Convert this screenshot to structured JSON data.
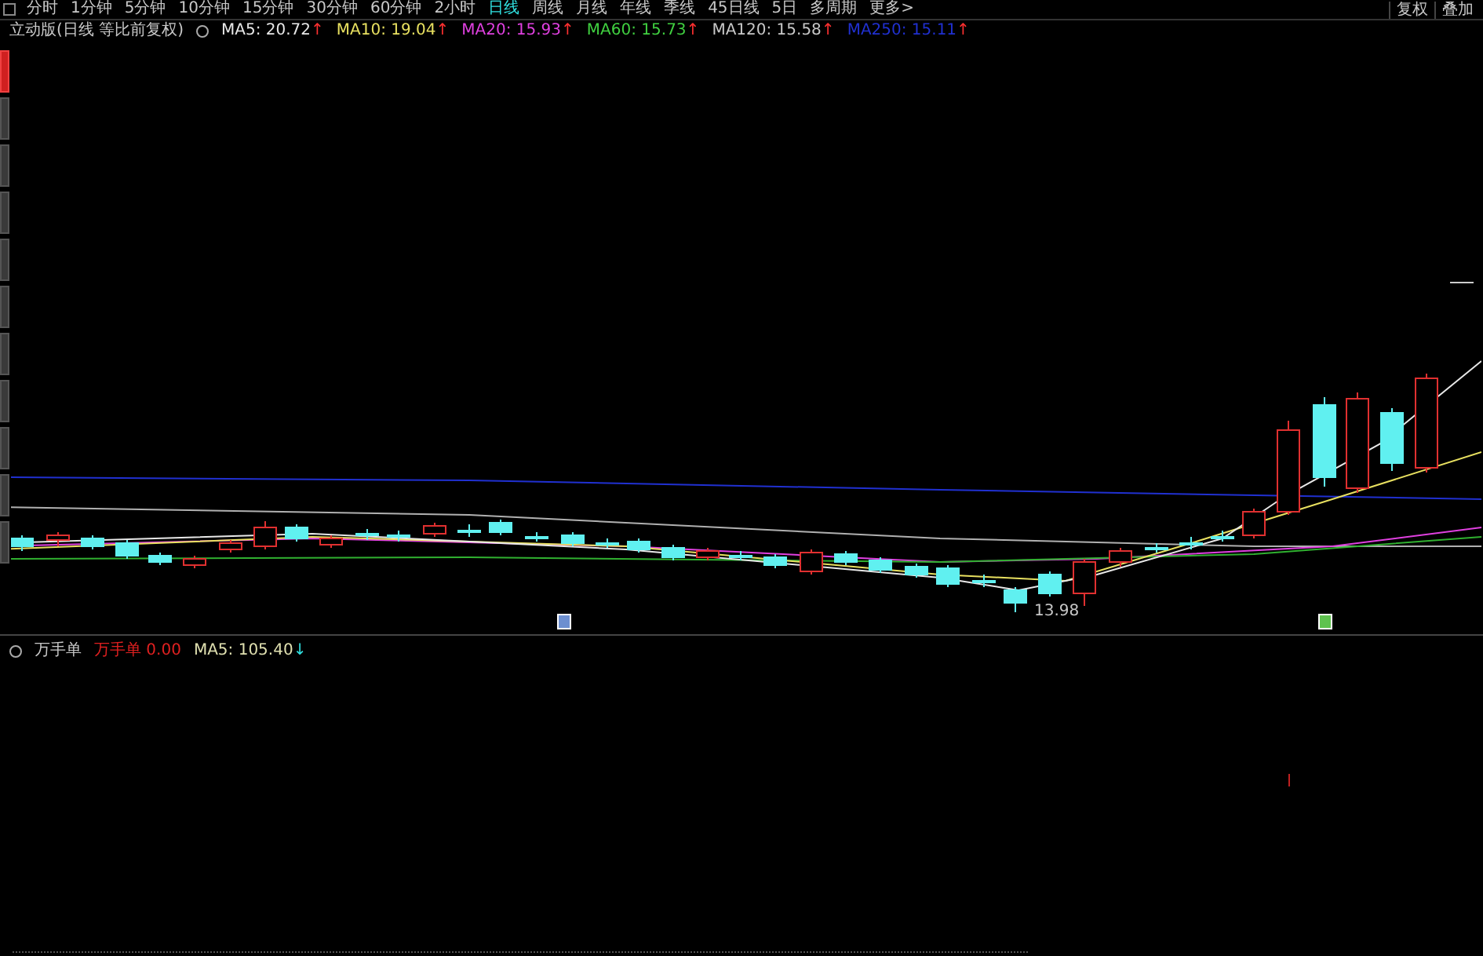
{
  "period_tabs": [
    {
      "label": "分时",
      "selected": false
    },
    {
      "label": "1分钟",
      "selected": false
    },
    {
      "label": "5分钟",
      "selected": false
    },
    {
      "label": "10分钟",
      "selected": false
    },
    {
      "label": "15分钟",
      "selected": false
    },
    {
      "label": "30分钟",
      "selected": false
    },
    {
      "label": "60分钟",
      "selected": false
    },
    {
      "label": "2小时",
      "selected": false
    },
    {
      "label": "日线",
      "selected": true
    },
    {
      "label": "周线",
      "selected": false
    },
    {
      "label": "月线",
      "selected": false
    },
    {
      "label": "年线",
      "selected": false
    },
    {
      "label": "季线",
      "selected": false
    },
    {
      "label": "45日线",
      "selected": false
    },
    {
      "label": "5日",
      "selected": false
    },
    {
      "label": "多周期",
      "selected": false
    },
    {
      "label": "更多>",
      "selected": false
    }
  ],
  "toolbar_buttons": [
    "复权",
    "叠加"
  ],
  "side_tabs": [
    {
      "selected": true
    },
    {
      "selected": false
    },
    {
      "selected": false
    },
    {
      "selected": false
    },
    {
      "selected": false
    },
    {
      "selected": false
    },
    {
      "selected": false
    },
    {
      "selected": false
    },
    {
      "selected": false
    },
    {
      "selected": false
    },
    {
      "selected": false
    }
  ],
  "main_legend": {
    "title": "立动版(日线 等比前复权)",
    "indicators": [
      {
        "label": "MA5: 20.72",
        "arrow": {
          "text": "↑",
          "color": "#ff3030"
        },
        "color": "#e8e8e8"
      },
      {
        "label": "MA10: 19.04",
        "arrow": {
          "text": "↑",
          "color": "#ff3030"
        },
        "color": "#e8e060"
      },
      {
        "label": "MA20: 15.93",
        "arrow": {
          "text": "↑",
          "color": "#ff3030"
        },
        "color": "#e040e0"
      },
      {
        "label": "MA60: 15.73",
        "arrow": {
          "text": "↑",
          "color": "#ff3030"
        },
        "color": "#40d040"
      },
      {
        "label": "MA120: 15.58",
        "arrow": {
          "text": "↑",
          "color": "#ff3030"
        },
        "color": "#c8c8c8"
      },
      {
        "label": "MA250: 15.11",
        "arrow": {
          "text": "↑",
          "color": "#ff3030"
        },
        "color": "#2030d0"
      }
    ]
  },
  "low_label": "13.98",
  "signal_markers": [
    {
      "color": "#6d8fd0"
    },
    {
      "color": "#5fc24f"
    }
  ],
  "sub_panel": {
    "title": "万手单",
    "indicators": [
      {
        "label": "万手单  0.00",
        "color": "#e02020"
      },
      {
        "label": "MA5: 105.40",
        "arrow": {
          "text": "↓",
          "color": "#30e0e0"
        },
        "color": "#e0e0b0"
      }
    ]
  }
}
